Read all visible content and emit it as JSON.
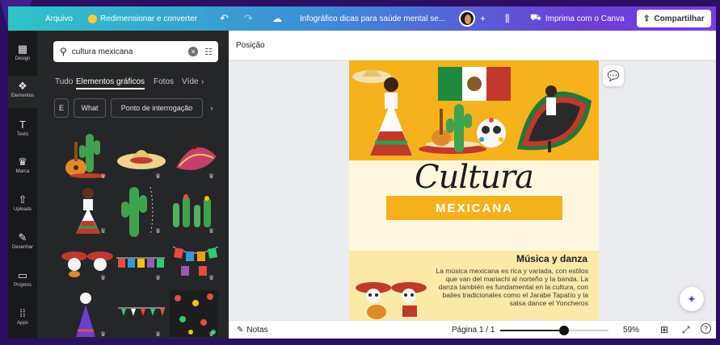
{
  "topbar": {
    "file_label": "Arquivo",
    "resize_label": "Redimensionar e converter",
    "doc_title": "Infográfico dicas para saúde mental se...",
    "print_label": "Imprima com o Canva",
    "share_label": "Compartilhar"
  },
  "rail": {
    "items": [
      {
        "label": "Design",
        "icon": "design-icon"
      },
      {
        "label": "Elementos",
        "icon": "elements-icon"
      },
      {
        "label": "Texto",
        "icon": "text-icon"
      },
      {
        "label": "Marca",
        "icon": "brand-icon"
      },
      {
        "label": "Uploads",
        "icon": "upload-icon"
      },
      {
        "label": "Desenhar",
        "icon": "draw-icon"
      },
      {
        "label": "Projetos",
        "icon": "folder-icon"
      },
      {
        "label": "Apps",
        "icon": "apps-icon"
      }
    ]
  },
  "panel": {
    "search_value": "cultura mexicana",
    "tabs": [
      "Tudo",
      "Elementos gráficos",
      "Fotos",
      "Víde"
    ],
    "chips": [
      "E",
      "What",
      "Ponto de interrogação"
    ]
  },
  "editor": {
    "position_label": "Posição",
    "title_script": "Cultura",
    "subtitle": "MEXICANA",
    "section_heading": "Música y danza",
    "section_body": "La música mexicana es rica y variada, con estilos que van del mariachi al norteño y la banda. La danza también es fundamental en la cultura, con bailes tradicionales como el Jarabe Tapatío y la salsa dance el Yoncheros"
  },
  "statusbar": {
    "notes_label": "Notas",
    "page_label": "Página 1 / 1",
    "zoom_label": "59%",
    "zoom_fraction": 0.59
  },
  "colors": {
    "accent_yellow": "#f5b21c",
    "panel_bg": "#252627",
    "rail_bg": "#18191b",
    "frame": "#2a0f63"
  }
}
